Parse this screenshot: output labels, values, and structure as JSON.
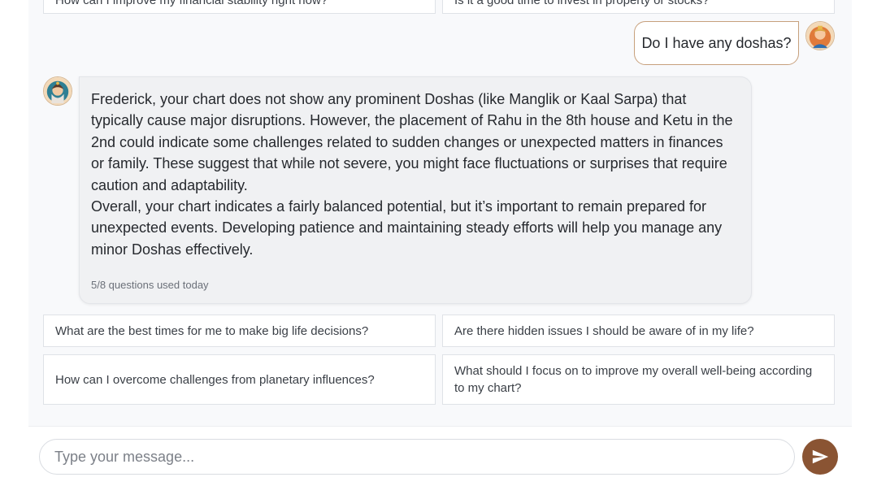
{
  "suggestions_top": [
    "How can I improve my financial stability right now?",
    "Is it a good time to invest in property or stocks?"
  ],
  "user_message": "Do I have any doshas?",
  "bot_reply": {
    "paragraphs": [
      "Frederick, your chart does not show any prominent Doshas (like Manglik or Kaal Sarpa) that typically cause major disruptions. However, the placement of Rahu in the 8th house and Ketu in the 2nd could indicate some challenges related to sudden changes or unexpected matters in finances or family. These suggest that while not severe, you might face fluctuations or surprises that require caution and adaptability.",
      "Overall, your chart indicates a fairly balanced potential, but it’s important to remain prepared for unexpected events. Developing patience and maintaining steady efforts will help you manage any minor Doshas effectively."
    ],
    "usage": "5/8 questions used today"
  },
  "suggestions": [
    "What are the best times for me to make big life decisions?",
    "Are there hidden issues I should be aware of in my life?",
    "How can I overcome challenges from planetary influences?",
    "What should I focus on to improve my overall well-being according to my chart?"
  ],
  "input": {
    "placeholder": "Type your message..."
  },
  "send": {
    "icon": "send-icon"
  },
  "colors": {
    "accent": "#8a5433",
    "user_bubble_border": "#c7a07c",
    "bot_bubble_bg": "#f0f1f3",
    "panel_bg": "#f8f9fb"
  }
}
